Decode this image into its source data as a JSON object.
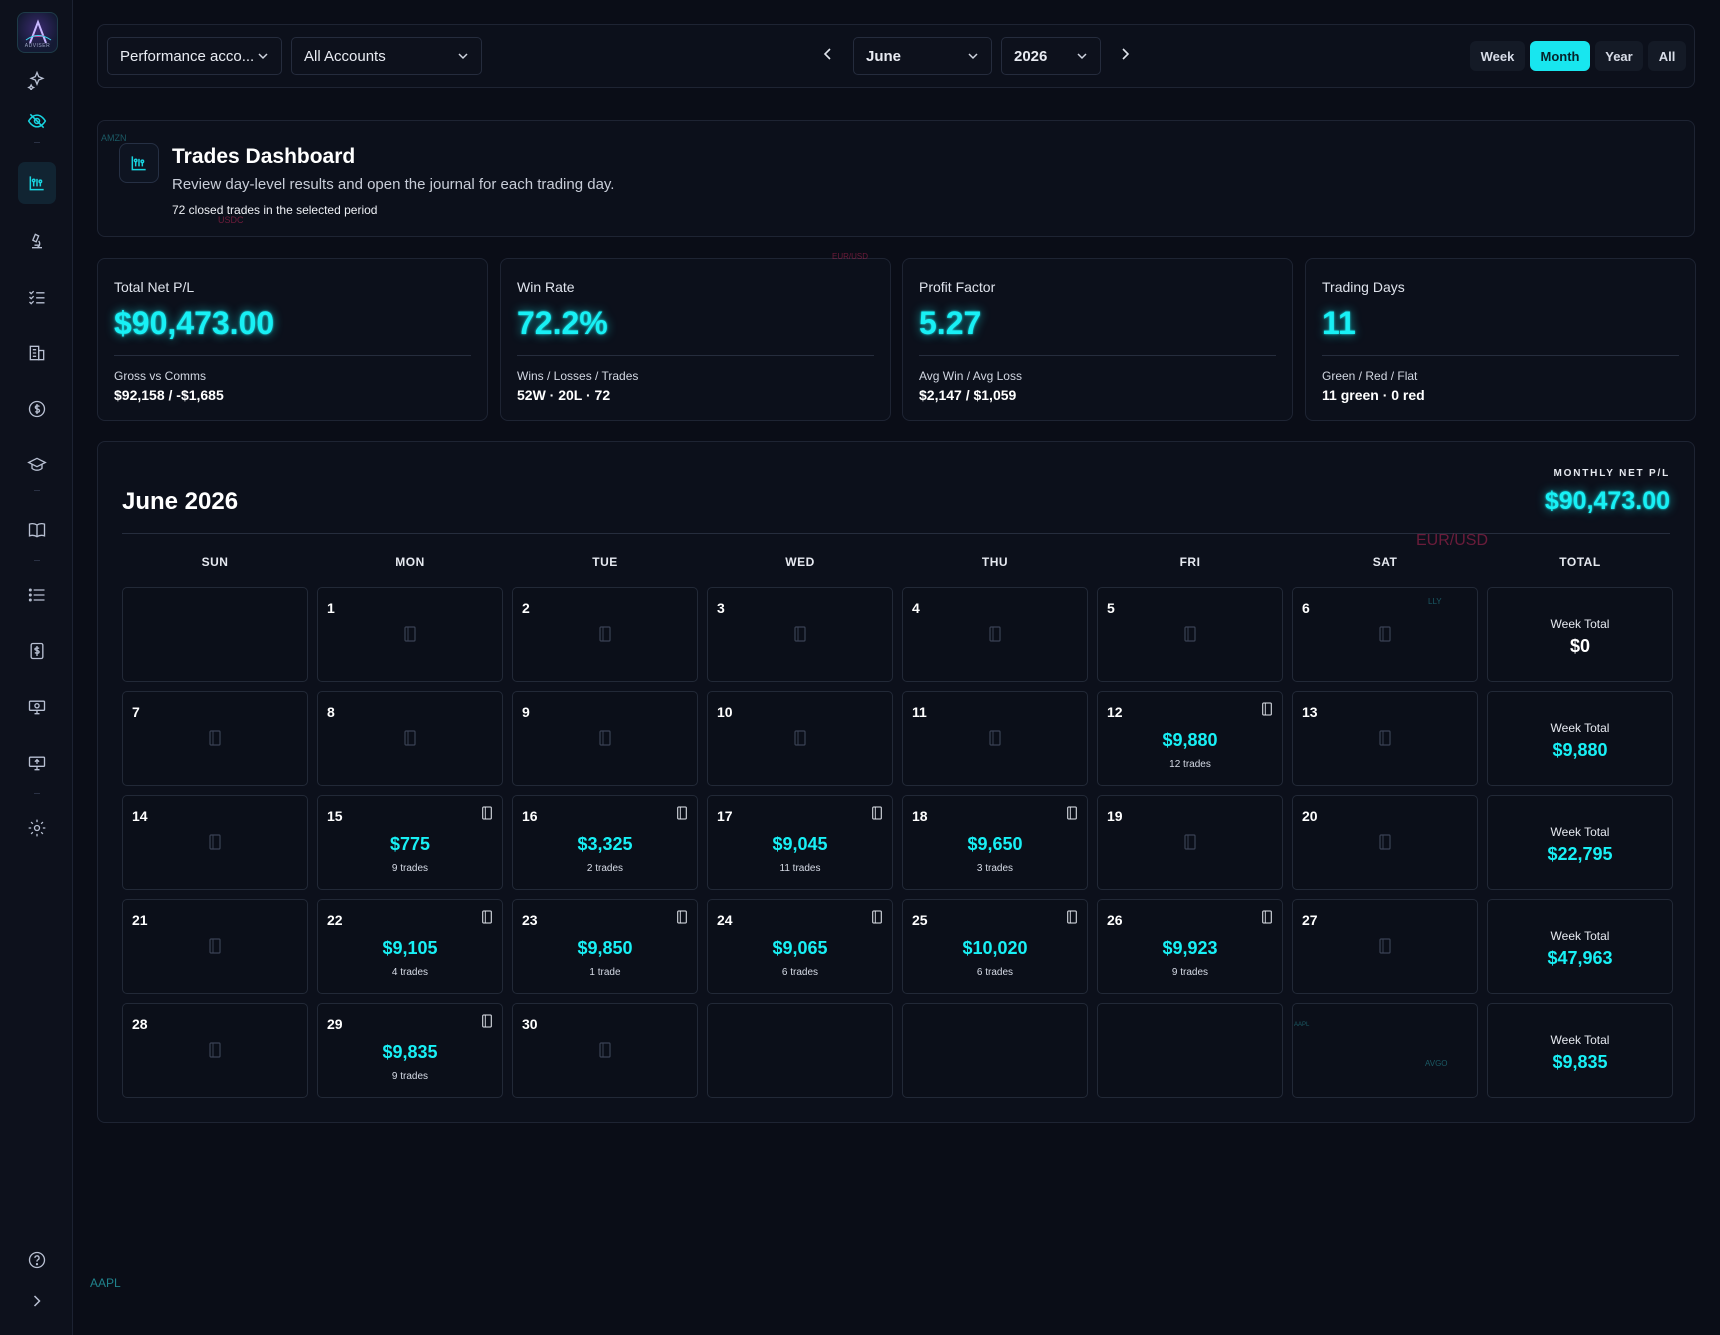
{
  "sidebar": {
    "logo_text": "ADVISER",
    "icons": [
      "sparkles-icon",
      "eye-off-icon",
      "chart-icon",
      "microscope-icon",
      "checklist-icon",
      "building-icon",
      "dollar-circle-icon",
      "graduation-cap-icon",
      "book-icon",
      "list-icon",
      "dollar-receipt-icon",
      "monitor-dollar-icon",
      "monitor-upload-icon",
      "settings-icon",
      "help-icon",
      "expand-icon"
    ]
  },
  "topbar": {
    "account_filter": "Performance acco...",
    "account_select": "All Accounts",
    "month": "June",
    "year": "2026",
    "ranges": [
      "Week",
      "Month",
      "Year",
      "All"
    ],
    "active_range": "Month"
  },
  "banner": {
    "title": "Trades Dashboard",
    "subtitle": "Review day-level results and open the journal for each trading day.",
    "count": "72 closed trades in the selected period"
  },
  "stats": [
    {
      "label": "Total Net P/L",
      "value": "$90,473.00",
      "sub_label": "Gross vs Comms",
      "sub_value": "$92,158 / -$1,685"
    },
    {
      "label": "Win Rate",
      "value": "72.2%",
      "sub_label": "Wins / Losses / Trades",
      "sub_value": "52W · 20L · 72"
    },
    {
      "label": "Profit Factor",
      "value": "5.27",
      "sub_label": "Avg Win / Avg Loss",
      "sub_value": "$2,147 / $1,059"
    },
    {
      "label": "Trading Days",
      "value": "11",
      "sub_label": "Green / Red / Flat",
      "sub_value": "11 green · 0 red"
    }
  ],
  "calendar": {
    "title": "June 2026",
    "monthly_label": "MONTHLY NET P/L",
    "monthly_value": "$90,473.00",
    "headers": [
      "SUN",
      "MON",
      "TUE",
      "WED",
      "THU",
      "FRI",
      "SAT",
      "TOTAL"
    ],
    "week_total_label": "Week Total",
    "weeks": [
      {
        "days": [
          {
            "day": ""
          },
          {
            "day": "1"
          },
          {
            "day": "2"
          },
          {
            "day": "3"
          },
          {
            "day": "4"
          },
          {
            "day": "5"
          },
          {
            "day": "6"
          }
        ],
        "total": "$0"
      },
      {
        "days": [
          {
            "day": "7"
          },
          {
            "day": "8"
          },
          {
            "day": "9"
          },
          {
            "day": "10"
          },
          {
            "day": "11"
          },
          {
            "day": "12",
            "pl": "$9,880",
            "trades": "12 trades"
          },
          {
            "day": "13"
          }
        ],
        "total": "$9,880"
      },
      {
        "days": [
          {
            "day": "14"
          },
          {
            "day": "15",
            "pl": "$775",
            "trades": "9 trades"
          },
          {
            "day": "16",
            "pl": "$3,325",
            "trades": "2 trades"
          },
          {
            "day": "17",
            "pl": "$9,045",
            "trades": "11 trades"
          },
          {
            "day": "18",
            "pl": "$9,650",
            "trades": "3 trades"
          },
          {
            "day": "19"
          },
          {
            "day": "20"
          }
        ],
        "total": "$22,795"
      },
      {
        "days": [
          {
            "day": "21"
          },
          {
            "day": "22",
            "pl": "$9,105",
            "trades": "4 trades"
          },
          {
            "day": "23",
            "pl": "$9,850",
            "trades": "1 trade"
          },
          {
            "day": "24",
            "pl": "$9,065",
            "trades": "6 trades"
          },
          {
            "day": "25",
            "pl": "$10,020",
            "trades": "6 trades"
          },
          {
            "day": "26",
            "pl": "$9,923",
            "trades": "9 trades"
          },
          {
            "day": "27"
          }
        ],
        "total": "$47,963"
      },
      {
        "days": [
          {
            "day": "28"
          },
          {
            "day": "29",
            "pl": "$9,835",
            "trades": "9 trades"
          },
          {
            "day": "30"
          },
          {
            "day": ""
          },
          {
            "day": ""
          },
          {
            "day": ""
          },
          {
            "day": ""
          }
        ],
        "total": "$9,835"
      }
    ]
  },
  "background_tickers": [
    "AMZN",
    "USDC",
    "EUR/USD",
    "EUR/USD",
    "LLY",
    "AAPL",
    "AVGO",
    "AAPL"
  ]
}
